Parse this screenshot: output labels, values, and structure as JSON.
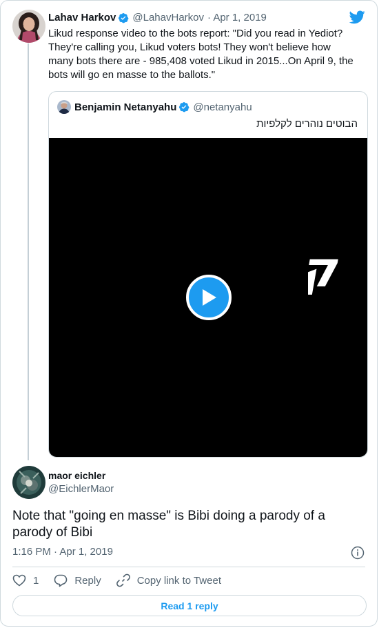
{
  "colors": {
    "accent": "#1d9bf0",
    "muted": "#536471",
    "text": "#0f1419",
    "border": "#cfd9de"
  },
  "icons": {
    "logo": "twitter-bird-icon",
    "verified": "verified-badge-icon",
    "play": "play-icon",
    "like": "heart-icon",
    "reply": "reply-bubble-icon",
    "copy": "link-icon",
    "info": "info-icon"
  },
  "parent_tweet": {
    "author_name": "Lahav Harkov",
    "author_handle": "@LahavHarkov",
    "date": "· Apr 1, 2019",
    "text": "Likud response video to the bots report: \"Did you read in Yediot? They're calling you, Likud voters bots! They won't believe how many bots there are - 985,408 voted Likud in 2015...On April 9, the bots will go en masse to the ballots.\"",
    "quoted": {
      "author_name": "Benjamin Netanyahu",
      "author_handle": "@netanyahu",
      "text": "הבוטים נוהרים לקלפיות",
      "video_logo_glyph": "ק"
    }
  },
  "reply_tweet": {
    "author_name": "maor eichler",
    "author_handle": "@EichlerMaor",
    "text": "Note that \"going en masse\" is Bibi doing a parody of a parody of Bibi",
    "timestamp": "1:16 PM · Apr 1, 2019"
  },
  "actions": {
    "like_count": "1",
    "reply_label": "Reply",
    "copy_label": "Copy link to Tweet",
    "read_reply_label": "Read 1 reply"
  }
}
